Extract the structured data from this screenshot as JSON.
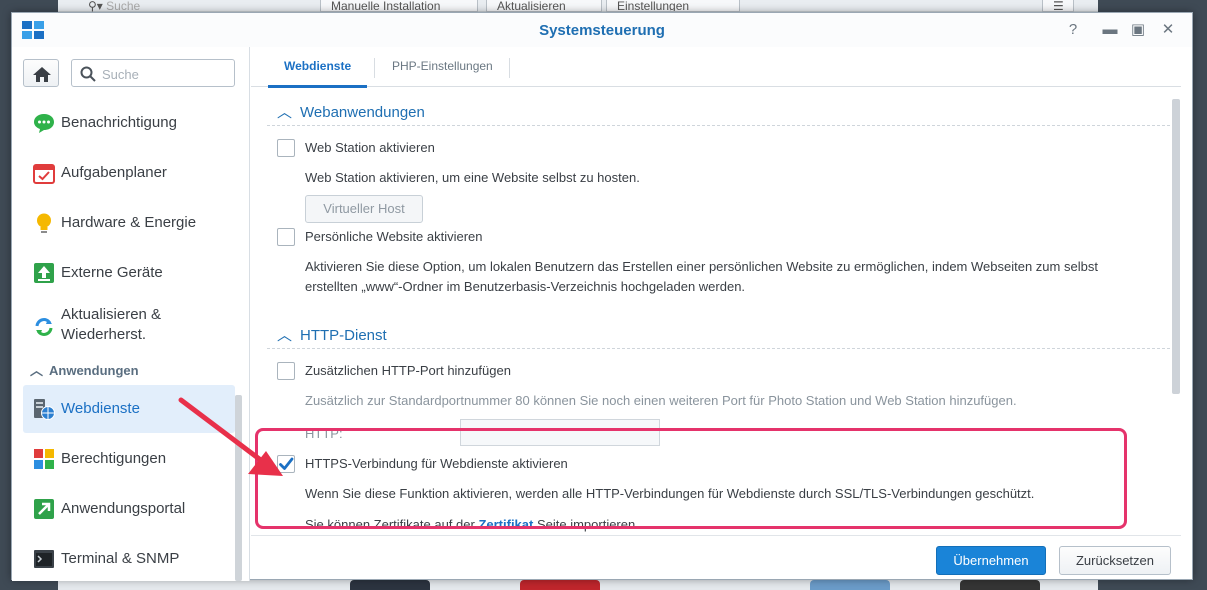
{
  "background": {
    "search_placeholder": "Suche",
    "buttons": [
      "Manuelle Installation",
      "Aktualisieren",
      "Einstellungen"
    ]
  },
  "window": {
    "title": "Systemsteuerung",
    "controls": [
      "help-icon",
      "minimize-icon",
      "maximize-icon",
      "close-icon"
    ]
  },
  "sidebar": {
    "search_placeholder": "Suche",
    "items": [
      {
        "label": "Benachrichtigung",
        "icon": "chat-bubble-icon"
      },
      {
        "label": "Aufgabenplaner",
        "icon": "calendar-icon"
      },
      {
        "label": "Hardware & Energie",
        "icon": "lightbulb-icon"
      },
      {
        "label": "Externe Geräte",
        "icon": "upload-icon"
      },
      {
        "label": "Aktualisieren & Wiederherst.",
        "icon": "refresh-icon"
      },
      {
        "label": "Webdienste",
        "icon": "web-services-icon"
      },
      {
        "label": "Berechtigungen",
        "icon": "permissions-icon"
      },
      {
        "label": "Anwendungsportal",
        "icon": "portal-icon"
      },
      {
        "label": "Terminal & SNMP",
        "icon": "terminal-icon"
      }
    ],
    "section_label": "Anwendungen",
    "active_item": "Webdienste"
  },
  "tabs": [
    {
      "label": "Webdienste",
      "active": true
    },
    {
      "label": "PHP-Einstellungen",
      "active": false
    }
  ],
  "webapps": {
    "heading": "Webanwendungen",
    "webstation_label": "Web Station aktivieren",
    "webstation_checked": false,
    "webstation_desc": "Web Station aktivieren, um eine Website selbst zu hosten.",
    "virtual_host_button": "Virtueller Host",
    "personal_label": "Persönliche Website aktivieren",
    "personal_checked": false,
    "personal_desc_line1": "Aktivieren Sie diese Option, um lokalen Benutzern das Erstellen einer persönlichen Website zu ermöglichen, indem Webseiten zum selbst",
    "personal_desc_line2": "erstellten „www“-Ordner im Benutzerbasis-Verzeichnis hochgeladen werden."
  },
  "http": {
    "heading": "HTTP-Dienst",
    "extra_port_label": "Zusätzlichen HTTP-Port hinzufügen",
    "extra_port_checked": false,
    "extra_port_desc": "Zusätzlich zur Standardportnummer 80 können Sie noch einen weiteren Port für Photo Station und Web Station hinzufügen.",
    "http_field_label": "HTTP:",
    "http_field_value": "",
    "https_label": "HTTPS-Verbindung für Webdienste aktivieren",
    "https_checked": true,
    "https_desc": "Wenn Sie diese Funktion aktivieren, werden alle HTTP-Verbindungen für Webdienste durch SSL/TLS-Verbindungen geschützt.",
    "cert_prefix": "Sie können Zertifikate auf der ",
    "cert_link": "Zertifikat",
    "cert_suffix": " Seite importieren."
  },
  "footer": {
    "apply": "Übernehmen",
    "reset": "Zurücksetzen"
  },
  "colors": {
    "accent": "#1b70c4",
    "annotation": "#e5336b"
  }
}
